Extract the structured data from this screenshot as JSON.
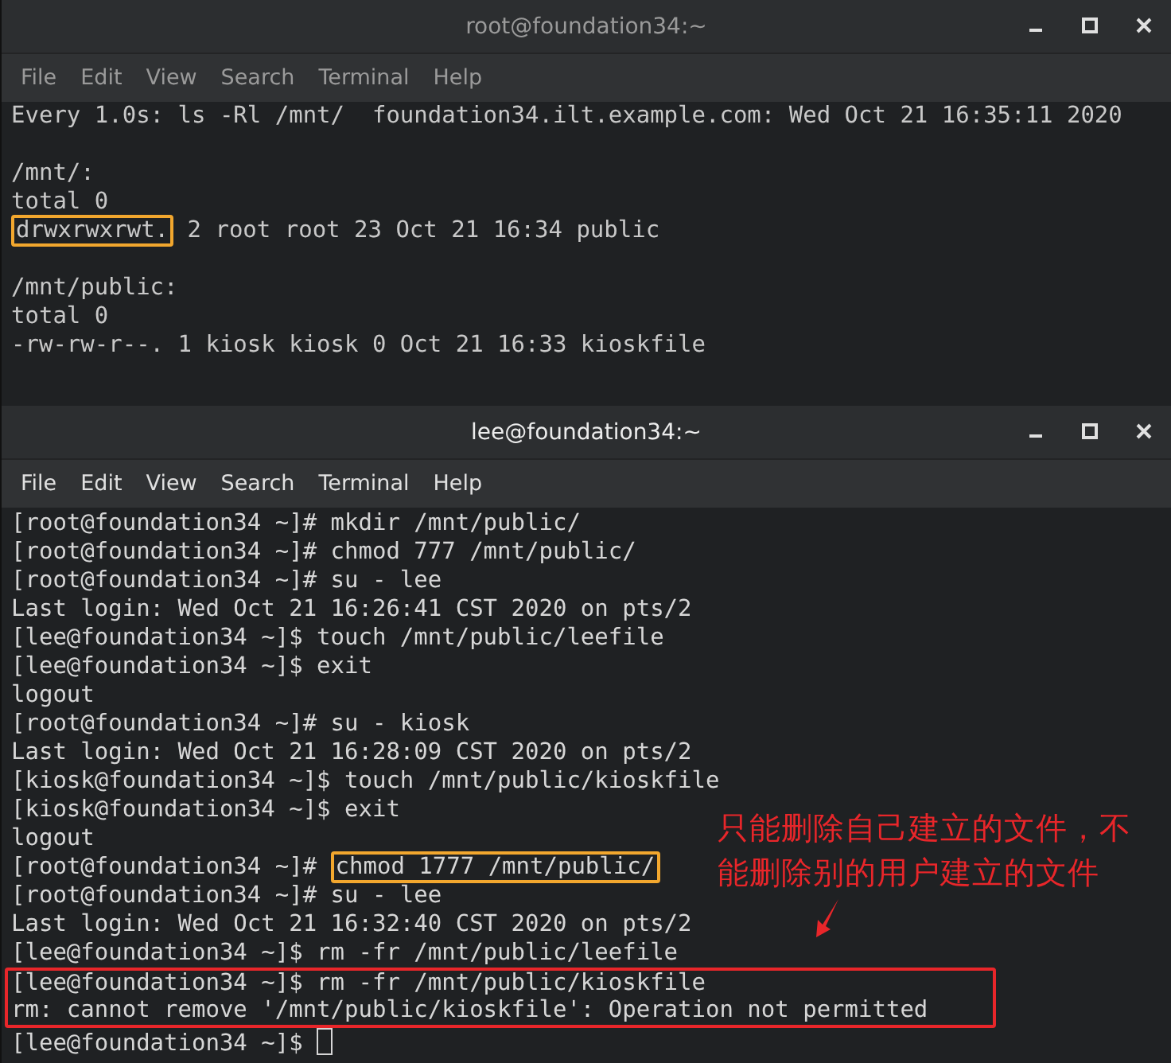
{
  "windows": [
    {
      "title": "root@foundation34:~",
      "focused": false,
      "menu": [
        "File",
        "Edit",
        "View",
        "Search",
        "Terminal",
        "Help"
      ],
      "content": [
        {
          "kind": "line",
          "segments": [
            {
              "text": "Every 1.0s: ls -Rl /mnt/  foundation34.ilt.example.com: Wed Oct 21 16:35:11 2020",
              "boxed": false
            }
          ]
        },
        {
          "kind": "blank"
        },
        {
          "kind": "line",
          "segments": [
            {
              "text": "/mnt/:",
              "boxed": false
            }
          ]
        },
        {
          "kind": "line",
          "segments": [
            {
              "text": "total 0",
              "boxed": false
            }
          ]
        },
        {
          "kind": "line",
          "segments": [
            {
              "text": "drwxrwxrwt.",
              "boxed": true,
              "color": "#f2a72e"
            },
            {
              "text": " 2 root root 23 Oct 21 16:34 public",
              "boxed": false
            }
          ]
        },
        {
          "kind": "blank"
        },
        {
          "kind": "line",
          "segments": [
            {
              "text": "/mnt/public:",
              "boxed": false
            }
          ]
        },
        {
          "kind": "line",
          "segments": [
            {
              "text": "total 0",
              "boxed": false
            }
          ]
        },
        {
          "kind": "line",
          "segments": [
            {
              "text": "-rw-rw-r--. 1 kiosk kiosk 0 Oct 21 16:33 kioskfile",
              "boxed": false
            }
          ]
        }
      ]
    },
    {
      "title": "lee@foundation34:~",
      "focused": true,
      "menu": [
        "File",
        "Edit",
        "View",
        "Search",
        "Terminal",
        "Help"
      ],
      "annotation": "只能删除自己建立的文件，不能删除别的用户建立的文件",
      "content": [
        {
          "kind": "line",
          "segments": [
            {
              "text": "[root@foundation34 ~]# mkdir /mnt/public/",
              "boxed": false
            }
          ]
        },
        {
          "kind": "line",
          "segments": [
            {
              "text": "[root@foundation34 ~]# chmod 777 /mnt/public/",
              "boxed": false
            }
          ]
        },
        {
          "kind": "line",
          "segments": [
            {
              "text": "[root@foundation34 ~]# su - lee",
              "boxed": false
            }
          ]
        },
        {
          "kind": "line",
          "segments": [
            {
              "text": "Last login: Wed Oct 21 16:26:41 CST 2020 on pts/2",
              "boxed": false
            }
          ]
        },
        {
          "kind": "line",
          "segments": [
            {
              "text": "[lee@foundation34 ~]$ touch /mnt/public/leefile",
              "boxed": false
            }
          ]
        },
        {
          "kind": "line",
          "segments": [
            {
              "text": "[lee@foundation34 ~]$ exit",
              "boxed": false
            }
          ]
        },
        {
          "kind": "line",
          "segments": [
            {
              "text": "logout",
              "boxed": false
            }
          ]
        },
        {
          "kind": "line",
          "segments": [
            {
              "text": "[root@foundation34 ~]# su - kiosk",
              "boxed": false
            }
          ]
        },
        {
          "kind": "line",
          "segments": [
            {
              "text": "Last login: Wed Oct 21 16:28:09 CST 2020 on pts/2",
              "boxed": false
            }
          ]
        },
        {
          "kind": "line",
          "segments": [
            {
              "text": "[kiosk@foundation34 ~]$ touch /mnt/public/kioskfile",
              "boxed": false
            }
          ]
        },
        {
          "kind": "line",
          "segments": [
            {
              "text": "[kiosk@foundation34 ~]$ exit",
              "boxed": false
            }
          ]
        },
        {
          "kind": "line",
          "segments": [
            {
              "text": "logout",
              "boxed": false
            }
          ]
        },
        {
          "kind": "line",
          "segments": [
            {
              "text": "[root@foundation34 ~]# ",
              "boxed": false
            },
            {
              "text": "chmod 1777 /mnt/public/",
              "boxed": true,
              "color": "#f2a72e"
            }
          ]
        },
        {
          "kind": "line",
          "segments": [
            {
              "text": "[root@foundation34 ~]# su - lee",
              "boxed": false
            }
          ]
        },
        {
          "kind": "line",
          "segments": [
            {
              "text": "Last login: Wed Oct 21 16:32:40 CST 2020 on pts/2",
              "boxed": false
            }
          ]
        },
        {
          "kind": "line",
          "segments": [
            {
              "text": "[lee@foundation34 ~]$ rm -fr /mnt/public/leefile",
              "boxed": false
            }
          ]
        },
        {
          "kind": "boxed",
          "color": "#e8262a",
          "lines": [
            "[lee@foundation34 ~]$ rm -fr /mnt/public/kioskfile",
            "rm: cannot remove '/mnt/public/kioskfile': Operation not permitted"
          ]
        },
        {
          "kind": "prompt",
          "text": "[lee@foundation34 ~]$ "
        }
      ]
    }
  ]
}
